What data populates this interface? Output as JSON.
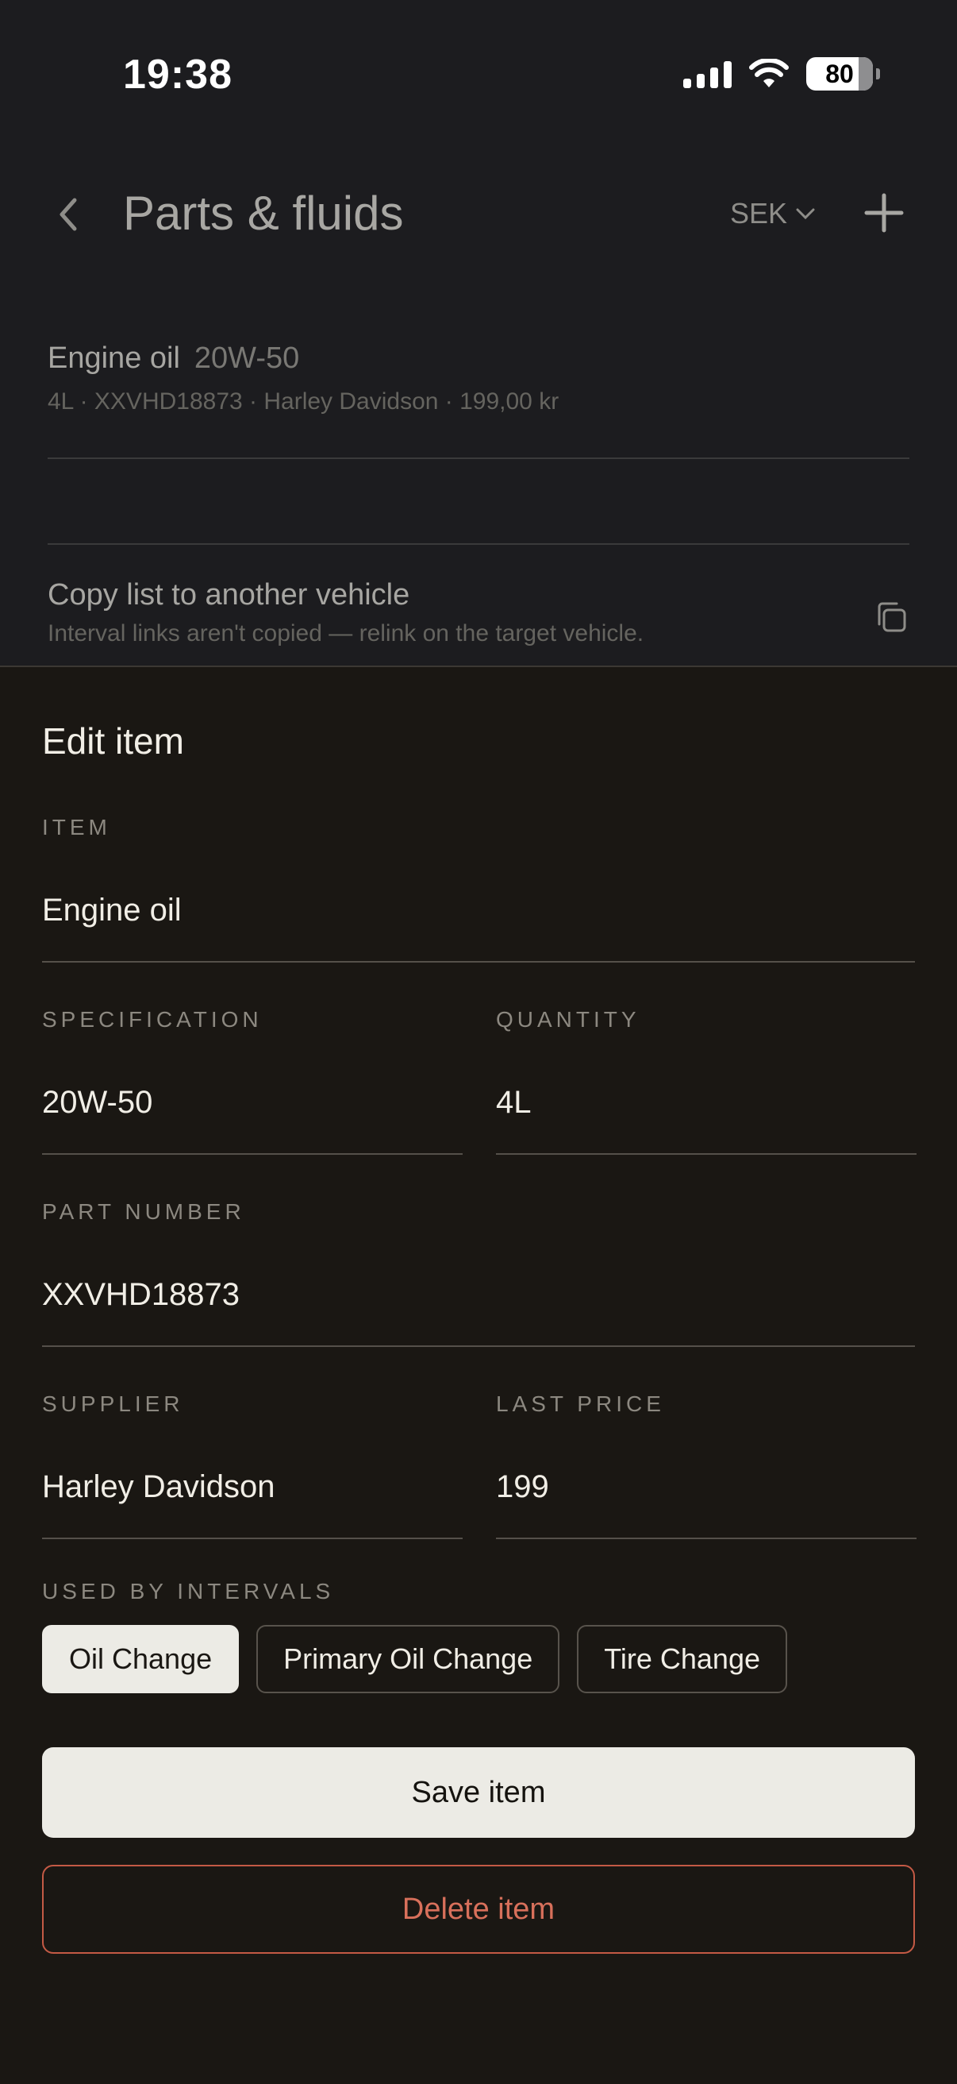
{
  "status_bar": {
    "time": "19:38",
    "battery": "80"
  },
  "header": {
    "title": "Parts & fluids",
    "currency": "SEK"
  },
  "list": {
    "item": {
      "name": "Engine oil",
      "spec": "20W-50",
      "details": "4L · XXVHD18873 · Harley Davidson · 199,00 kr"
    },
    "copy": {
      "title": "Copy list to another vehicle",
      "subtitle": "Interval links aren't copied — relink on the target vehicle."
    }
  },
  "sheet": {
    "title": "Edit item",
    "fields": {
      "item": {
        "label": "ITEM",
        "value": "Engine oil"
      },
      "specification": {
        "label": "SPECIFICATION",
        "value": "20W-50"
      },
      "quantity": {
        "label": "QUANTITY",
        "value": "4L"
      },
      "part_number": {
        "label": "PART NUMBER",
        "value": "XXVHD18873"
      },
      "supplier": {
        "label": "SUPPLIER",
        "value": "Harley Davidson"
      },
      "last_price": {
        "label": "LAST PRICE",
        "value": "199"
      }
    },
    "intervals": {
      "label": "USED BY INTERVALS",
      "chips": [
        {
          "label": "Oil Change",
          "selected": true
        },
        {
          "label": "Primary Oil Change",
          "selected": false
        },
        {
          "label": "Tire Change",
          "selected": false
        }
      ]
    },
    "save_label": "Save item",
    "delete_label": "Delete item"
  },
  "colors": {
    "accent_danger": "#c45a45",
    "sheet_bg": "#1a1713",
    "screen_bg": "#1c1c1f"
  }
}
